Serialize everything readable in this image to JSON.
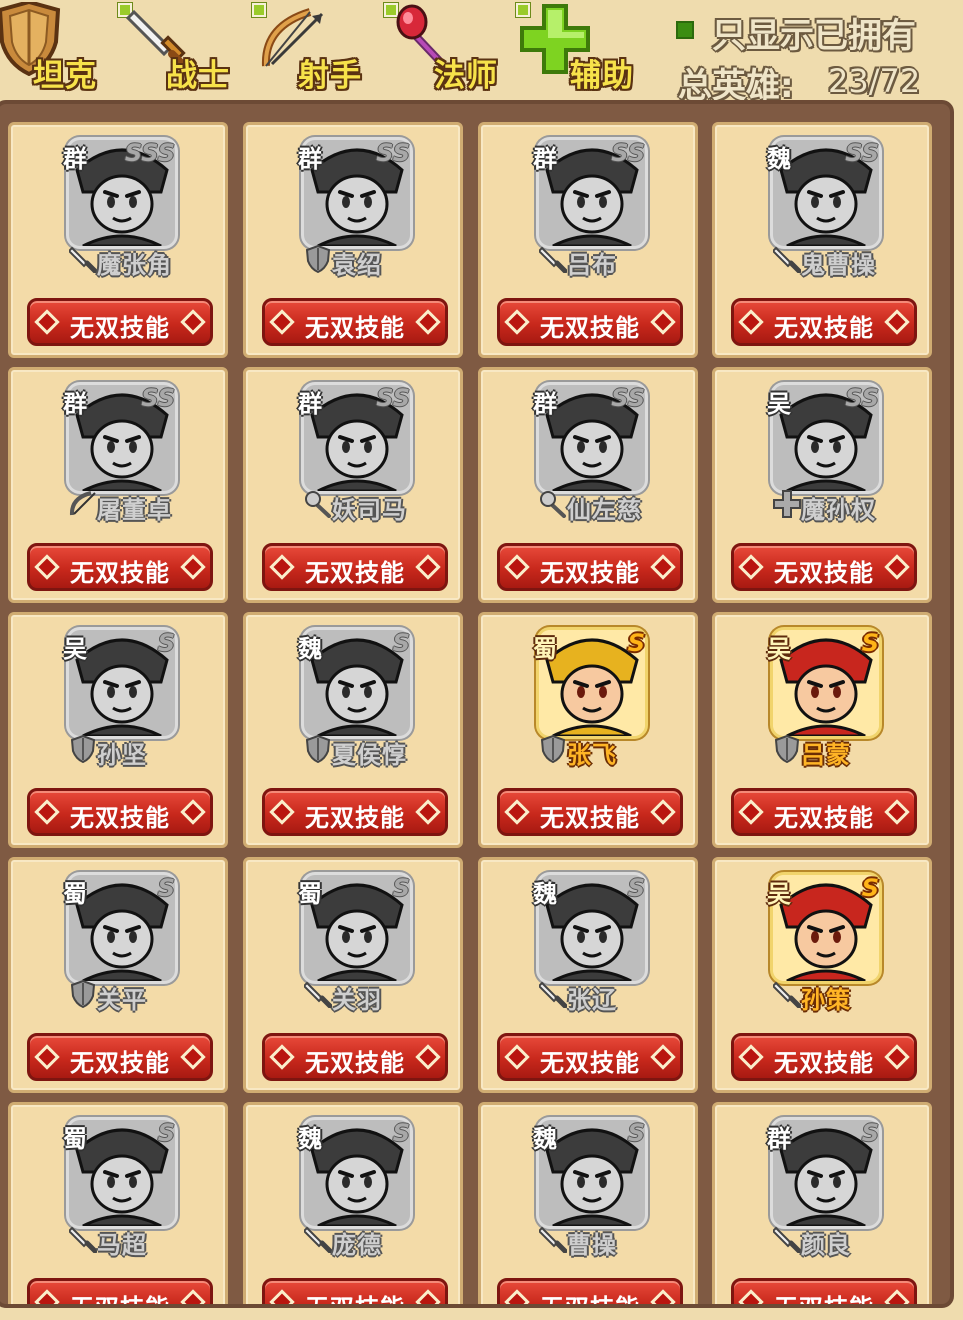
{
  "header": {
    "tabs": [
      {
        "label": "坦克",
        "icon": "shield-icon"
      },
      {
        "label": "战士",
        "icon": "sword-icon"
      },
      {
        "label": "射手",
        "icon": "bow-icon"
      },
      {
        "label": "法师",
        "icon": "staff-icon"
      },
      {
        "label": "辅助",
        "icon": "plus-icon"
      }
    ],
    "owned_only_label": "只显示已拥有",
    "total_label": "总英雄:",
    "total_value": "23/72"
  },
  "colors": {
    "tab_label": "#f7e24a",
    "skill_button": "#c8281c",
    "rank_gold": "#ffb417",
    "owned_check": "#3b8d12"
  },
  "heroes": [
    {
      "faction": "群",
      "rank": "SSS",
      "name": "魔张角",
      "role": "sword",
      "owned": false
    },
    {
      "faction": "群",
      "rank": "SS",
      "name": "袁绍",
      "role": "shield",
      "owned": false
    },
    {
      "faction": "群",
      "rank": "SS",
      "name": "吕布",
      "role": "sword",
      "owned": false
    },
    {
      "faction": "魏",
      "rank": "SS",
      "name": "鬼曹操",
      "role": "sword",
      "owned": false
    },
    {
      "faction": "群",
      "rank": "SS",
      "name": "屠董卓",
      "role": "bow",
      "owned": false
    },
    {
      "faction": "群",
      "rank": "SS",
      "name": "妖司马",
      "role": "staff",
      "owned": false
    },
    {
      "faction": "群",
      "rank": "SS",
      "name": "仙左慈",
      "role": "staff",
      "owned": false
    },
    {
      "faction": "吴",
      "rank": "SS",
      "name": "魔孙权",
      "role": "plus",
      "owned": false
    },
    {
      "faction": "吴",
      "rank": "S",
      "name": "孙坚",
      "role": "shield",
      "owned": false
    },
    {
      "faction": "魏",
      "rank": "S",
      "name": "夏侯惇",
      "role": "shield",
      "owned": false
    },
    {
      "faction": "蜀",
      "rank": "S",
      "name": "张飞",
      "role": "shield",
      "owned": true
    },
    {
      "faction": "吴",
      "rank": "S",
      "name": "吕蒙",
      "role": "shield",
      "owned": true
    },
    {
      "faction": "蜀",
      "rank": "S",
      "name": "关平",
      "role": "shield",
      "owned": false
    },
    {
      "faction": "蜀",
      "rank": "S",
      "name": "关羽",
      "role": "sword",
      "owned": false
    },
    {
      "faction": "魏",
      "rank": "S",
      "name": "张辽",
      "role": "sword",
      "owned": false
    },
    {
      "faction": "吴",
      "rank": "S",
      "name": "孙策",
      "role": "sword",
      "owned": true
    },
    {
      "faction": "蜀",
      "rank": "S",
      "name": "马超",
      "role": "sword",
      "owned": false
    },
    {
      "faction": "魏",
      "rank": "S",
      "name": "庞德",
      "role": "sword",
      "owned": false
    },
    {
      "faction": "魏",
      "rank": "S",
      "name": "曹操",
      "role": "sword",
      "owned": false
    },
    {
      "faction": "群",
      "rank": "S",
      "name": "颜良",
      "role": "sword",
      "owned": false
    }
  ],
  "skill_button_label": "无双技能"
}
